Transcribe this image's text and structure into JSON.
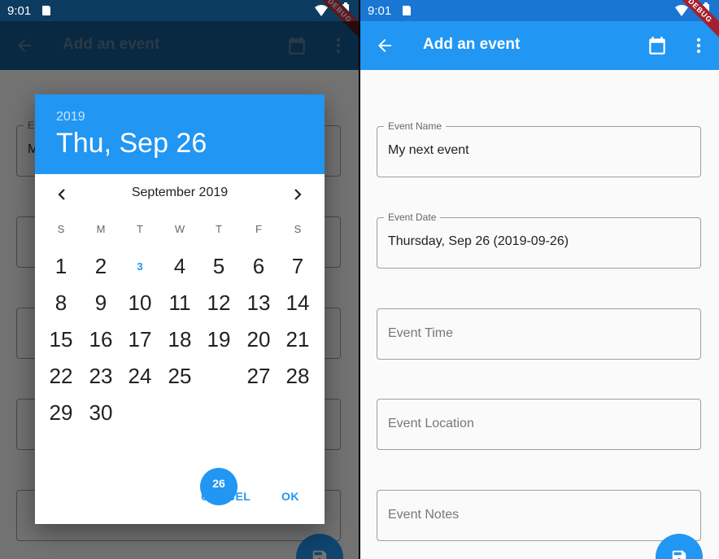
{
  "status": {
    "time": "9:01"
  },
  "appbar": {
    "title": "Add an event"
  },
  "debug_banner": "DEBUG",
  "form": {
    "event_name": {
      "label": "Event Name",
      "value": "My next event"
    },
    "event_date": {
      "label": "Event Date",
      "value": "Thursday, Sep 26 (2019-09-26)"
    },
    "event_time": {
      "hint": "Event Time"
    },
    "event_location": {
      "hint": "Event Location"
    },
    "event_notes": {
      "hint": "Event Notes"
    }
  },
  "left_fields": {
    "name_label_fragment": "E",
    "name_value_fragment": "M"
  },
  "date_picker": {
    "year": "2019",
    "selected_date": "Thu, Sep 26",
    "month_label": "September 2019",
    "weekdays": [
      "S",
      "M",
      "T",
      "W",
      "T",
      "F",
      "S"
    ],
    "days": [
      "1",
      "2",
      "3",
      "4",
      "5",
      "6",
      "7",
      "8",
      "9",
      "10",
      "11",
      "12",
      "13",
      "14",
      "15",
      "16",
      "17",
      "18",
      "19",
      "20",
      "21",
      "22",
      "23",
      "24",
      "25",
      "26",
      "27",
      "28",
      "29",
      "30"
    ],
    "first_weekday_index": 0,
    "today": "3",
    "selected_day": "26",
    "cancel_label": "CANCEL",
    "ok_label": "OK"
  },
  "colors": {
    "primary": "#2196f3",
    "appbar_dim": "#14578e",
    "statusbar": "#1976d2",
    "statusbar_dim": "#0d3c61"
  }
}
